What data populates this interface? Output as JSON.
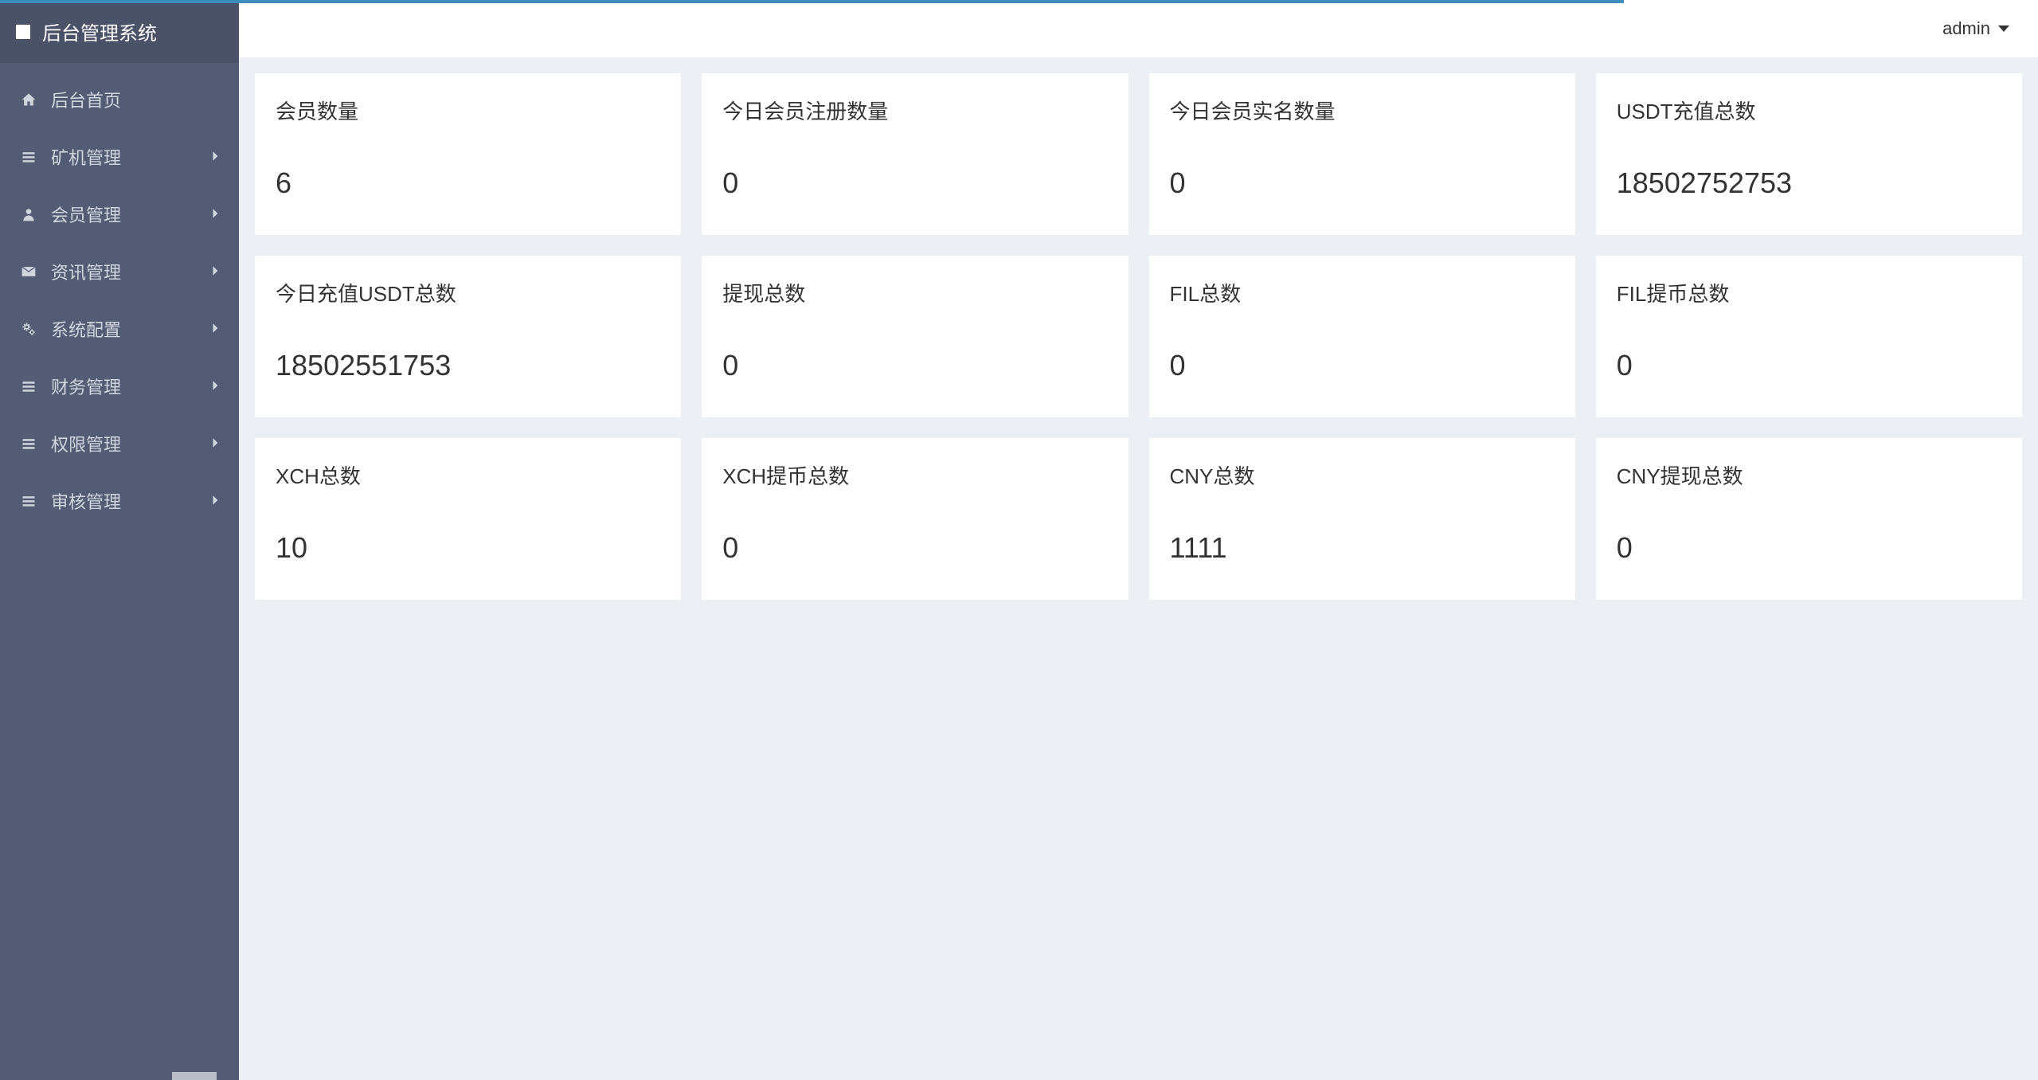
{
  "app": {
    "title": "后台管理系统"
  },
  "topbar": {
    "username": "admin"
  },
  "sidebar": {
    "items": [
      {
        "label": "后台首页",
        "icon": "home",
        "expandable": false
      },
      {
        "label": "矿机管理",
        "icon": "bars",
        "expandable": true
      },
      {
        "label": "会员管理",
        "icon": "user",
        "expandable": true
      },
      {
        "label": "资讯管理",
        "icon": "envelope",
        "expandable": true
      },
      {
        "label": "系统配置",
        "icon": "cogs",
        "expandable": true
      },
      {
        "label": "财务管理",
        "icon": "bars",
        "expandable": true
      },
      {
        "label": "权限管理",
        "icon": "bars",
        "expandable": true
      },
      {
        "label": "审核管理",
        "icon": "bars",
        "expandable": true
      }
    ]
  },
  "dashboard": {
    "cards": [
      {
        "title": "会员数量",
        "value": "6"
      },
      {
        "title": "今日会员注册数量",
        "value": "0"
      },
      {
        "title": "今日会员实名数量",
        "value": "0"
      },
      {
        "title": "USDT充值总数",
        "value": "18502752753"
      },
      {
        "title": "今日充值USDT总数",
        "value": "18502551753"
      },
      {
        "title": "提现总数",
        "value": "0"
      },
      {
        "title": "FIL总数",
        "value": "0"
      },
      {
        "title": "FIL提币总数",
        "value": "0"
      },
      {
        "title": "XCH总数",
        "value": "10"
      },
      {
        "title": "XCH提币总数",
        "value": "0"
      },
      {
        "title": "CNY总数",
        "value": "1111"
      },
      {
        "title": "CNY提现总数",
        "value": "0"
      }
    ]
  },
  "icons": {
    "home": "home",
    "bars": "bars",
    "user": "user",
    "envelope": "envelope",
    "cogs": "cogs"
  }
}
